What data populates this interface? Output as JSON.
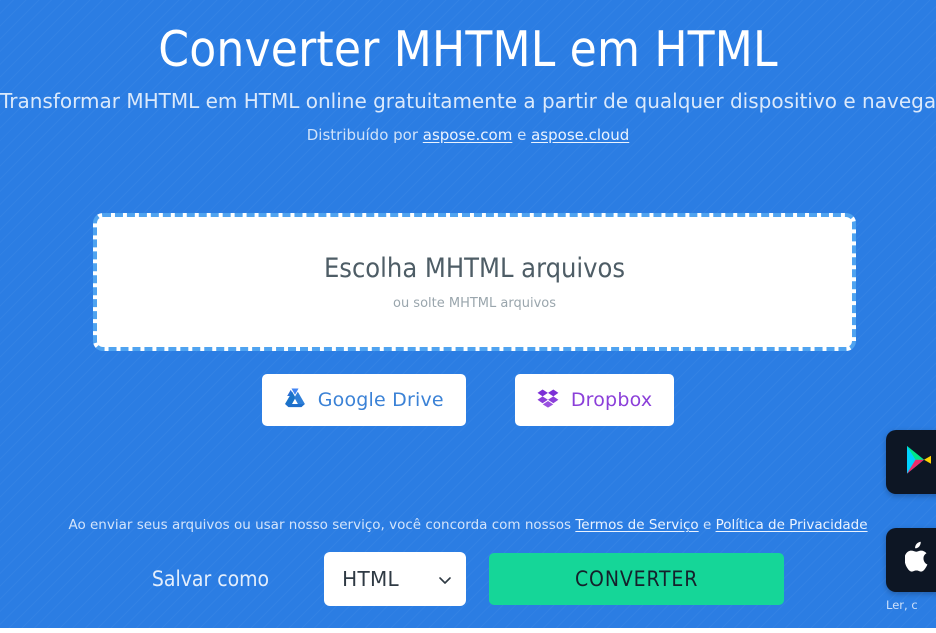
{
  "theme": {
    "background_blue": "#2b7de3",
    "accent_green": "#15d698",
    "dropzone_border": "#4fa3f0",
    "gdrive_blue": "#3b82d6",
    "dropbox_purple": "#8b3fd9"
  },
  "hero": {
    "title": "Converter MHTML em HTML",
    "subtitle": "Transformar MHTML em HTML online gratuitamente a partir de qualquer dispositivo e navegador",
    "credit_prefix": "Distribuído por ",
    "credit_link1": "aspose.com",
    "credit_separator": " e ",
    "credit_link2": "aspose.cloud"
  },
  "dropzone": {
    "title": "Escolha MHTML arquivos",
    "subtitle": "ou solte MHTML arquivos"
  },
  "cloud_buttons": [
    {
      "label": "Google Drive",
      "icon": "google-drive-icon"
    },
    {
      "label": "Dropbox",
      "icon": "dropbox-icon"
    }
  ],
  "terms": {
    "text_before": "Ao enviar seus arquivos ou usar nosso serviço, você concorda com nossos ",
    "link1": "Termos de Serviço",
    "separator": " e ",
    "link2": "Política de Privacidade"
  },
  "actions": {
    "save_as_label": "Salvar como",
    "format_value": "HTML",
    "convert_label": "CONVERTER"
  },
  "app_badges": {
    "google_play": "google-play-icon",
    "apple": "apple-icon",
    "caption": "Ler, c"
  }
}
